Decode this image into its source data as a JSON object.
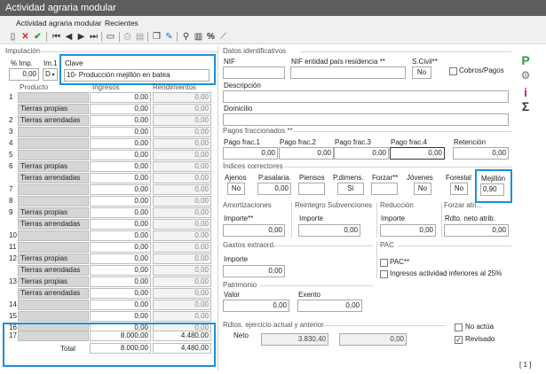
{
  "title": "Actividad agraria modular",
  "menu": [
    "Actividad agraria modular",
    "Recientes"
  ],
  "imputacion": {
    "section": "Imputación",
    "pct_label": "% Imp.",
    "pct_value": "0,00",
    "im_label": "Im.1",
    "im_value": "D",
    "clave_label": "Clave",
    "clave_value": "10- Producción mejillón en batea"
  },
  "grid": {
    "headers": [
      "Producto",
      "Ingresos",
      "Rendimientos"
    ],
    "rows": [
      {
        "num": "1",
        "producto": "",
        "ingresos": "0,00",
        "rend": "0,00"
      },
      {
        "num": "",
        "producto": "Tierras propias",
        "ingresos": "0,00",
        "rend": "0,00"
      },
      {
        "num": "2",
        "producto": "Tierras arrendadas",
        "ingresos": "0,00",
        "rend": "0,00"
      },
      {
        "num": "3",
        "producto": "",
        "ingresos": "0,00",
        "rend": "0,00"
      },
      {
        "num": "4",
        "producto": "",
        "ingresos": "0,00",
        "rend": "0,00"
      },
      {
        "num": "5",
        "producto": "",
        "ingresos": "0,00",
        "rend": "0,00"
      },
      {
        "num": "6",
        "producto": "Tierras propias",
        "ingresos": "0,00",
        "rend": "0,00"
      },
      {
        "num": "",
        "producto": "Tierras arrendadas",
        "ingresos": "0,00",
        "rend": "0,00"
      },
      {
        "num": "7",
        "producto": "",
        "ingresos": "0,00",
        "rend": "0,00"
      },
      {
        "num": "8",
        "producto": "",
        "ingresos": "0,00",
        "rend": "0,00"
      },
      {
        "num": "9",
        "producto": "Tierras propias",
        "ingresos": "0,00",
        "rend": "0,00"
      },
      {
        "num": "",
        "producto": "Tierras arrendadas",
        "ingresos": "0,00",
        "rend": "0,00"
      },
      {
        "num": "10",
        "producto": "",
        "ingresos": "0,00",
        "rend": "0,00"
      },
      {
        "num": "11",
        "producto": "",
        "ingresos": "0,00",
        "rend": "0,00"
      },
      {
        "num": "12",
        "producto": "Tierras propias",
        "ingresos": "0,00",
        "rend": "0,00"
      },
      {
        "num": "",
        "producto": "Tierras arrendadas",
        "ingresos": "0,00",
        "rend": "0,00"
      },
      {
        "num": "13",
        "producto": "Tierras propias",
        "ingresos": "0,00",
        "rend": "0,00"
      },
      {
        "num": "",
        "producto": "Tierras arrendadas",
        "ingresos": "0,00",
        "rend": "0,00"
      },
      {
        "num": "14",
        "producto": "",
        "ingresos": "0,00",
        "rend": "0,00"
      },
      {
        "num": "15",
        "producto": "",
        "ingresos": "0,00",
        "rend": "0,00"
      },
      {
        "num": "16",
        "producto": "",
        "ingresos": "0,00",
        "rend": "0,00"
      },
      {
        "num": "17",
        "producto": "",
        "ingresos": "8.000,00",
        "rend": "4.480,00"
      }
    ],
    "total_label": "Total",
    "total_ingresos": "8.000,00",
    "total_rend": "4.480,00"
  },
  "datos": {
    "section": "Datos identificativos",
    "nif_label": "NIF",
    "nif_pais_label": "NIF entidad país residencia **",
    "scivil_label": "S.Civil**",
    "scivil_value": "No",
    "cobros_label": "Cobros/Pagos",
    "descripcion_label": "Descripción",
    "domicilio_label": "Domicilio"
  },
  "pagos": {
    "section": "Pagos fraccionados **",
    "labels": [
      "Pago frac.1",
      "Pago frac.2",
      "Pago frac.3",
      "Pago frac.4",
      "Retención"
    ],
    "values": [
      "0,00",
      "0,00",
      "0,00",
      "0,00",
      "0,00"
    ]
  },
  "indices": {
    "section": "Índices correctores",
    "labels": [
      "Ajenos",
      "P.asalaria.",
      "Piensos",
      "P.dimens.",
      "Forzar**",
      "Jóvenes",
      "Forestal",
      "Mejillón"
    ],
    "values": [
      "No",
      "0,00",
      "",
      "Sí",
      "",
      "No",
      "No",
      "0,90"
    ]
  },
  "amort": {
    "section": "Amortizaciones",
    "label": "Importe**",
    "value": "0,00"
  },
  "reintegro": {
    "section": "Reintegro Subvenciones",
    "label": "Importe",
    "value": "0,00"
  },
  "reduccion": {
    "section": "Reducción",
    "label": "Importe",
    "value": "0,00"
  },
  "forzar": {
    "section": "Forzar atri...",
    "label": "Rdto. neto atrib.",
    "value": "0,00"
  },
  "gastos": {
    "section": "Gastos extraord.",
    "label": "Importe",
    "value": "0,00"
  },
  "pac": {
    "section": "PAC",
    "pac_label": "PAC**",
    "ingresos_label": "Ingresos actividad inferiores al 25%"
  },
  "patrimonio": {
    "section": "Patrimonio",
    "valor_label": "Valor",
    "valor_value": "0,00",
    "exento_label": "Exento",
    "exento_value": "0,00"
  },
  "rdtos": {
    "section": "Rdtos. ejercicio actual y anterior",
    "neto_label": "Neto",
    "actual": "3.830,40",
    "anterior": "0,00"
  },
  "flags": {
    "no_actua": "No actúa",
    "revisado": "Revisado"
  },
  "page_indicator": "[ 1 ]",
  "side_icons": {
    "p": "P",
    "i": "i",
    "sigma": "Σ"
  }
}
